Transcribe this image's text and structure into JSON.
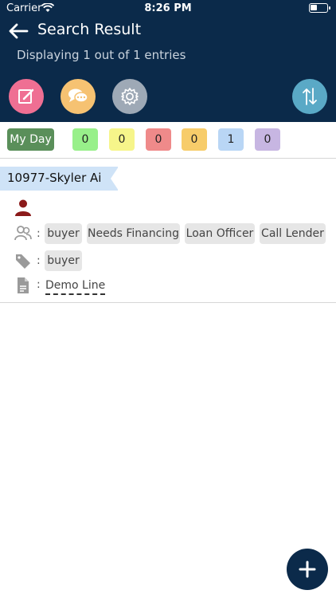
{
  "status_bar": {
    "carrier": "Carrier",
    "time": "8:26 PM"
  },
  "header": {
    "title": "Search Result",
    "subtitle": "Displaying 1 out of 1 entries",
    "actions": {
      "edit_icon": "edit-icon",
      "chat_icon": "chat-icon",
      "settings_icon": "gear-icon",
      "sort_icon": "sort-icon"
    },
    "colors": {
      "background": "#0b2a4a",
      "edit": "#ef6f93",
      "chat": "#f6c272",
      "settings": "#9ea9b6",
      "sort": "#5aa9c6"
    }
  },
  "filters": {
    "my_day_label": "My Day",
    "counters": [
      {
        "value": "0",
        "color": "#98f08a"
      },
      {
        "value": "0",
        "color": "#f6f58a"
      },
      {
        "value": "0",
        "color": "#ef8a8a"
      },
      {
        "value": "0",
        "color": "#f7cc6a"
      },
      {
        "value": "1",
        "color": "#b9d6f5"
      },
      {
        "value": "0",
        "color": "#c7b6e2"
      }
    ]
  },
  "result": {
    "name": "10977-Skyler Ai",
    "roles": [
      "buyer",
      "Needs Financing",
      "Loan Officer",
      "Call Lender"
    ],
    "tags": [
      "buyer"
    ],
    "note": "Demo Line",
    "colon": ":"
  }
}
